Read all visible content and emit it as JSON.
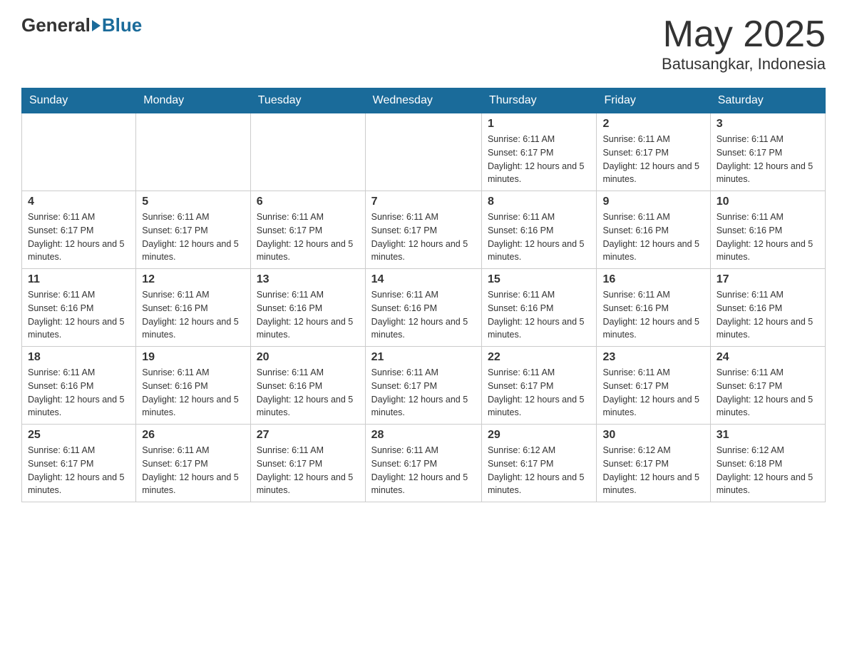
{
  "header": {
    "logo_text_general": "General",
    "logo_text_blue": "Blue",
    "month_title": "May 2025",
    "location": "Batusangkar, Indonesia"
  },
  "weekdays": [
    "Sunday",
    "Monday",
    "Tuesday",
    "Wednesday",
    "Thursday",
    "Friday",
    "Saturday"
  ],
  "weeks": [
    [
      {
        "day": "",
        "info": ""
      },
      {
        "day": "",
        "info": ""
      },
      {
        "day": "",
        "info": ""
      },
      {
        "day": "",
        "info": ""
      },
      {
        "day": "1",
        "info": "Sunrise: 6:11 AM\nSunset: 6:17 PM\nDaylight: 12 hours and 5 minutes."
      },
      {
        "day": "2",
        "info": "Sunrise: 6:11 AM\nSunset: 6:17 PM\nDaylight: 12 hours and 5 minutes."
      },
      {
        "day": "3",
        "info": "Sunrise: 6:11 AM\nSunset: 6:17 PM\nDaylight: 12 hours and 5 minutes."
      }
    ],
    [
      {
        "day": "4",
        "info": "Sunrise: 6:11 AM\nSunset: 6:17 PM\nDaylight: 12 hours and 5 minutes."
      },
      {
        "day": "5",
        "info": "Sunrise: 6:11 AM\nSunset: 6:17 PM\nDaylight: 12 hours and 5 minutes."
      },
      {
        "day": "6",
        "info": "Sunrise: 6:11 AM\nSunset: 6:17 PM\nDaylight: 12 hours and 5 minutes."
      },
      {
        "day": "7",
        "info": "Sunrise: 6:11 AM\nSunset: 6:17 PM\nDaylight: 12 hours and 5 minutes."
      },
      {
        "day": "8",
        "info": "Sunrise: 6:11 AM\nSunset: 6:16 PM\nDaylight: 12 hours and 5 minutes."
      },
      {
        "day": "9",
        "info": "Sunrise: 6:11 AM\nSunset: 6:16 PM\nDaylight: 12 hours and 5 minutes."
      },
      {
        "day": "10",
        "info": "Sunrise: 6:11 AM\nSunset: 6:16 PM\nDaylight: 12 hours and 5 minutes."
      }
    ],
    [
      {
        "day": "11",
        "info": "Sunrise: 6:11 AM\nSunset: 6:16 PM\nDaylight: 12 hours and 5 minutes."
      },
      {
        "day": "12",
        "info": "Sunrise: 6:11 AM\nSunset: 6:16 PM\nDaylight: 12 hours and 5 minutes."
      },
      {
        "day": "13",
        "info": "Sunrise: 6:11 AM\nSunset: 6:16 PM\nDaylight: 12 hours and 5 minutes."
      },
      {
        "day": "14",
        "info": "Sunrise: 6:11 AM\nSunset: 6:16 PM\nDaylight: 12 hours and 5 minutes."
      },
      {
        "day": "15",
        "info": "Sunrise: 6:11 AM\nSunset: 6:16 PM\nDaylight: 12 hours and 5 minutes."
      },
      {
        "day": "16",
        "info": "Sunrise: 6:11 AM\nSunset: 6:16 PM\nDaylight: 12 hours and 5 minutes."
      },
      {
        "day": "17",
        "info": "Sunrise: 6:11 AM\nSunset: 6:16 PM\nDaylight: 12 hours and 5 minutes."
      }
    ],
    [
      {
        "day": "18",
        "info": "Sunrise: 6:11 AM\nSunset: 6:16 PM\nDaylight: 12 hours and 5 minutes."
      },
      {
        "day": "19",
        "info": "Sunrise: 6:11 AM\nSunset: 6:16 PM\nDaylight: 12 hours and 5 minutes."
      },
      {
        "day": "20",
        "info": "Sunrise: 6:11 AM\nSunset: 6:16 PM\nDaylight: 12 hours and 5 minutes."
      },
      {
        "day": "21",
        "info": "Sunrise: 6:11 AM\nSunset: 6:17 PM\nDaylight: 12 hours and 5 minutes."
      },
      {
        "day": "22",
        "info": "Sunrise: 6:11 AM\nSunset: 6:17 PM\nDaylight: 12 hours and 5 minutes."
      },
      {
        "day": "23",
        "info": "Sunrise: 6:11 AM\nSunset: 6:17 PM\nDaylight: 12 hours and 5 minutes."
      },
      {
        "day": "24",
        "info": "Sunrise: 6:11 AM\nSunset: 6:17 PM\nDaylight: 12 hours and 5 minutes."
      }
    ],
    [
      {
        "day": "25",
        "info": "Sunrise: 6:11 AM\nSunset: 6:17 PM\nDaylight: 12 hours and 5 minutes."
      },
      {
        "day": "26",
        "info": "Sunrise: 6:11 AM\nSunset: 6:17 PM\nDaylight: 12 hours and 5 minutes."
      },
      {
        "day": "27",
        "info": "Sunrise: 6:11 AM\nSunset: 6:17 PM\nDaylight: 12 hours and 5 minutes."
      },
      {
        "day": "28",
        "info": "Sunrise: 6:11 AM\nSunset: 6:17 PM\nDaylight: 12 hours and 5 minutes."
      },
      {
        "day": "29",
        "info": "Sunrise: 6:12 AM\nSunset: 6:17 PM\nDaylight: 12 hours and 5 minutes."
      },
      {
        "day": "30",
        "info": "Sunrise: 6:12 AM\nSunset: 6:17 PM\nDaylight: 12 hours and 5 minutes."
      },
      {
        "day": "31",
        "info": "Sunrise: 6:12 AM\nSunset: 6:18 PM\nDaylight: 12 hours and 5 minutes."
      }
    ]
  ]
}
